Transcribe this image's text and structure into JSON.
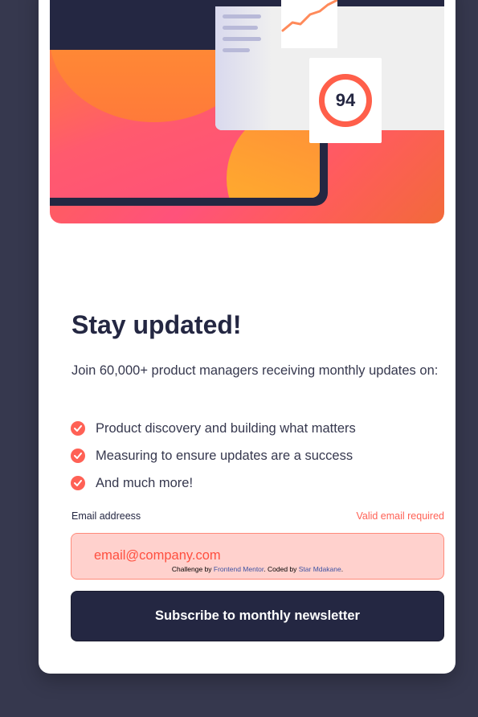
{
  "hero": {
    "score": "94",
    "colors": {
      "accent": "#ff6155",
      "dark": "#242742"
    },
    "icons": [
      "trend-line-icon",
      "score-ring-icon"
    ]
  },
  "content": {
    "title": "Stay updated!",
    "intro": "Join 60,000+ product managers receiving monthly updates on:",
    "features": [
      "Product discovery and building what matters",
      "Measuring to ensure updates are a success",
      "And much more!"
    ]
  },
  "form": {
    "email_label": "Email addreess",
    "error_text": "Valid email required",
    "email_value": "email@company.com",
    "submit_label": "Subscribe to monthly newsletter"
  },
  "attribution": {
    "prefix": "Challenge by ",
    "challenge_link": "Frontend Mentor",
    "middle": ". Coded by ",
    "author_link": "Star Mdakane",
    "suffix": "."
  },
  "colors": {
    "page_bg": "#36384e",
    "card_bg": "#ffffff",
    "error_bg": "#ffd1cd",
    "error_text": "#ff6155",
    "button_bg": "#242742"
  }
}
